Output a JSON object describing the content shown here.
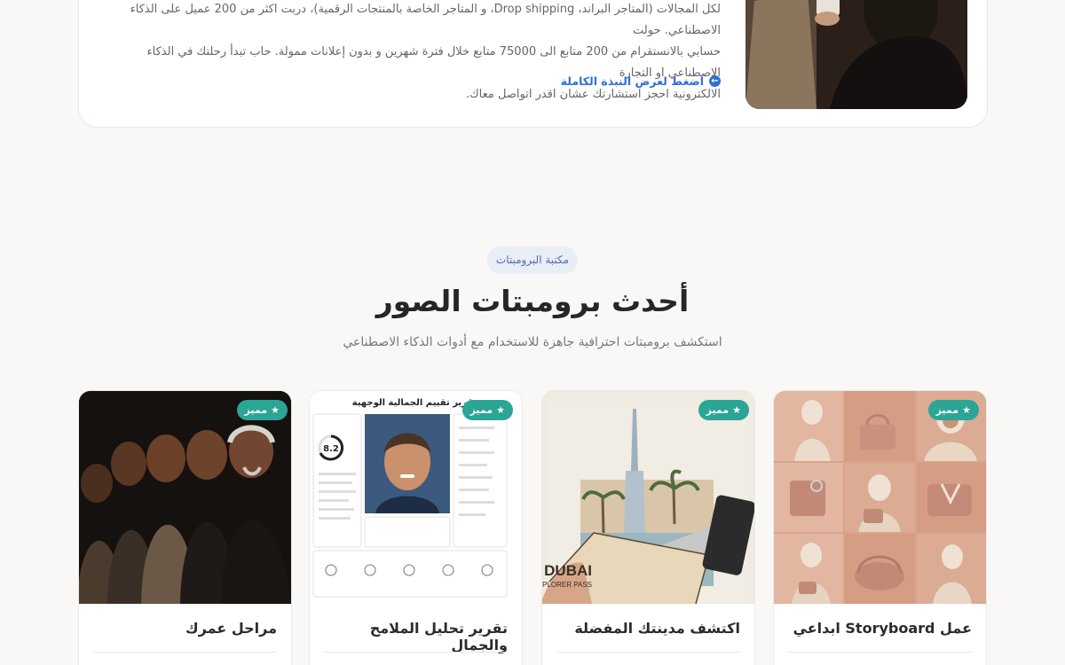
{
  "bio": {
    "line1": "لكل المجالات (المتاجر البراند، Drop shipping، و المتاجر الخاصة بالمنتجات الرقمية)، دربت اكثر من 200 عميل على الذكاء الاصطناعي. حولت",
    "line2": "حسابي بالانستقرام من 200 متابع الى 75000 متابع خلال فترة شهرين و بدون إعلانات ممولة. حاب تبدأ رحلتك في الذكاء الاصطناعي او التجارة",
    "line3": "الالكترونية احجز استشارتك عشان اقدر اتواصل معاك.",
    "link_label": "اضغط لعرض النبذة الكاملة",
    "link_icon": "arrow-left-icon"
  },
  "section": {
    "pill": "مكتبة البرومبتات",
    "title": "أحدث برومبتات الصور",
    "subtitle": "استكشف برومبتات احترافية جاهزة للاستخدام مع أدوات الذكاء الاصطناعي"
  },
  "badge_label": "مميز",
  "badge_color": "#2aa596",
  "cards": [
    {
      "title": "عمل Storyboard ابداعي"
    },
    {
      "title": "اكتشف مدينتك المفضلة",
      "img_text": {
        "city": "DUBAI",
        "sub": "EXPLORER PASS"
      }
    },
    {
      "title": "تقرير تحليل الملامح والجمال",
      "img_text": {
        "heading": "تقرير تقييم الجمالية الوجهية",
        "score": "8.2"
      }
    },
    {
      "title": "مراحل عمرك"
    }
  ]
}
